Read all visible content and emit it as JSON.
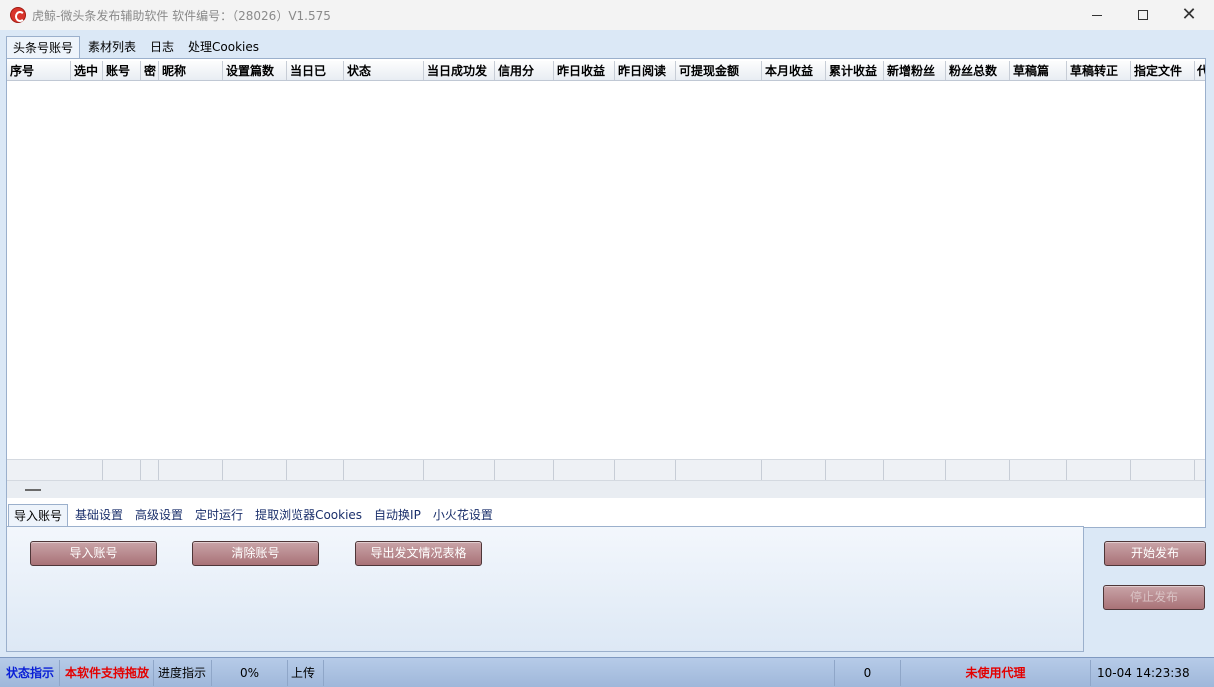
{
  "window": {
    "title": "虎鲸-微头条发布辅助软件 软件编号：（28026）V1.575"
  },
  "top_tabs": [
    {
      "label": "头条号账号",
      "active": true
    },
    {
      "label": "素材列表",
      "active": false
    },
    {
      "label": "日志",
      "active": false
    },
    {
      "label": "处理Cookies",
      "active": false
    }
  ],
  "grid": {
    "columns": [
      "序号",
      "选中",
      "账号",
      "密",
      "昵称",
      "设置篇数",
      "当日已",
      "状态",
      "当日成功发",
      "信用分",
      "昨日收益",
      "昨日阅读",
      "可提现金额",
      "本月收益",
      "累计收益",
      "新增粉丝",
      "粉丝总数",
      "草稿篇",
      "草稿转正",
      "指定文件",
      "代"
    ]
  },
  "bottom_tabs": [
    {
      "label": "导入账号",
      "active": true
    },
    {
      "label": "基础设置",
      "active": false
    },
    {
      "label": "高级设置",
      "active": false
    },
    {
      "label": "定时运行",
      "active": false
    },
    {
      "label": "提取浏览器Cookies",
      "active": false
    },
    {
      "label": "自动换IP",
      "active": false
    },
    {
      "label": "小火花设置",
      "active": false
    }
  ],
  "buttons": {
    "import": "导入账号",
    "clear": "清除账号",
    "export": "导出发文情况表格",
    "start": "开始发布",
    "stop": "停止发布"
  },
  "status": {
    "indicator": "状态指示",
    "drag_support": "本软件支持拖放",
    "progress_label": "进度指示",
    "progress_value": "0%",
    "upload_label": "上传",
    "count": "0",
    "proxy": "未使用代理",
    "datetime": "10-04  14:23:38"
  },
  "colors": {
    "status_blue": "#0a1fd6",
    "status_red": "#e40000",
    "button_fill": "#b98a8e"
  }
}
